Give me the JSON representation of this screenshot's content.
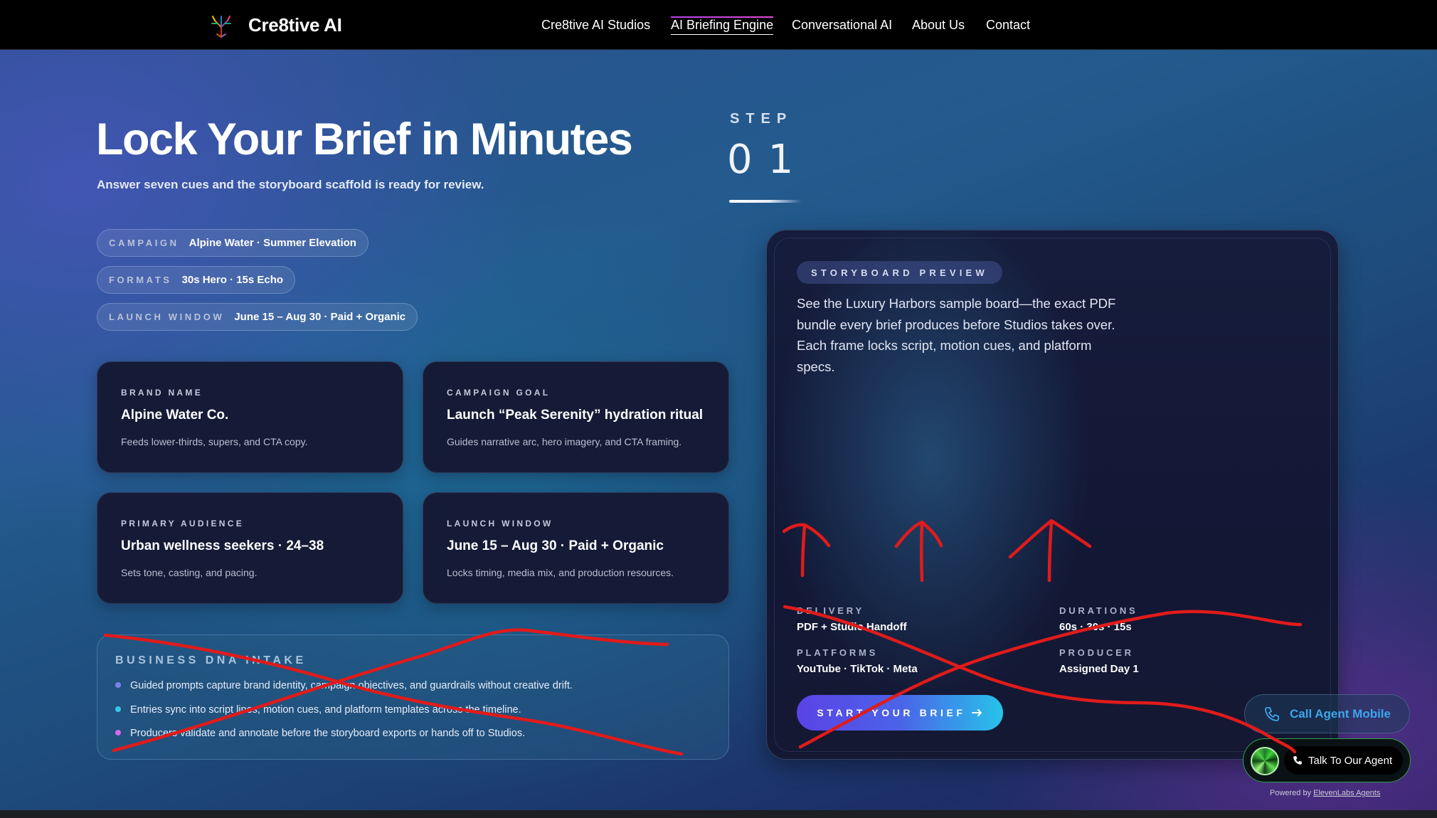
{
  "nav": {
    "brand": "Cre8tive AI",
    "links": [
      {
        "label": "Cre8tive AI Studios"
      },
      {
        "label": "AI Briefing Engine"
      },
      {
        "label": "Conversational AI"
      },
      {
        "label": "About Us"
      },
      {
        "label": "Contact"
      }
    ],
    "active_link": "AI Briefing Engine"
  },
  "hero": {
    "title": "Lock Your Brief in Minutes",
    "subtitle": "Answer seven cues and the storyboard scaffold is ready for review."
  },
  "step": {
    "label": "STEP",
    "number": "01"
  },
  "pills": [
    {
      "key": "CAMPAIGN",
      "value": "Alpine Water · Summer Elevation"
    },
    {
      "key": "FORMATS",
      "value": "30s Hero · 15s Echo"
    },
    {
      "key": "LAUNCH WINDOW",
      "value": "June 15 – Aug 30 · Paid + Organic"
    }
  ],
  "cards": [
    {
      "key": "BRAND NAME",
      "title": "Alpine Water Co.",
      "desc": "Feeds lower-thirds, supers, and CTA copy."
    },
    {
      "key": "CAMPAIGN GOAL",
      "title": "Launch “Peak Serenity” hydration ritual",
      "desc": "Guides narrative arc, hero imagery, and CTA framing."
    },
    {
      "key": "PRIMARY AUDIENCE",
      "title": "Urban wellness seekers · 24–38",
      "desc": "Sets tone, casting, and pacing."
    },
    {
      "key": "LAUNCH WINDOW",
      "title": "June 15 – Aug 30 · Paid + Organic",
      "desc": "Locks timing, media mix, and production resources."
    }
  ],
  "intake": {
    "title": "BUSINESS DNA INTAKE",
    "items": [
      {
        "text": "Guided prompts capture brand identity, campaign objectives, and guardrails without creative drift.",
        "color": "#7b82e8"
      },
      {
        "text": "Entries sync into script lines, motion cues, and platform templates across the timeline.",
        "color": "#35c9e6"
      },
      {
        "text": "Producers validate and annotate before the storyboard exports or hands off to Studios.",
        "color": "#d36be8"
      }
    ]
  },
  "preview": {
    "tag": "STORYBOARD PREVIEW",
    "body": "See the Luxury Harbors sample board—the exact PDF bundle every brief produces before Studios takes over. Each frame locks script, motion cues, and platform specs.",
    "specs": [
      {
        "key": "DELIVERY",
        "value": "PDF + Studio Handoff"
      },
      {
        "key": "DURATIONS",
        "value": "60s · 30s · 15s"
      },
      {
        "key": "PLATFORMS",
        "value": "YouTube · TikTok · Meta"
      },
      {
        "key": "PRODUCER",
        "value": "Assigned Day 1"
      }
    ],
    "cta_label": "START YOUR BRIEF"
  },
  "agent": {
    "call_mobile_label": "Call Agent Mobile",
    "talk_label": "Talk To Our Agent",
    "powered_prefix": "Powered by",
    "powered_link": "ElevenLabs Agents"
  },
  "icons": {
    "logo": "tree-logo-icon",
    "cta_arrow": "arrow-right-icon",
    "call": "phone-icon"
  },
  "colors": {
    "accent_purple": "#b545e6",
    "cta_start": "#5a43e6",
    "cta_end": "#27c3ea",
    "agent_blue": "#3ca6ee",
    "agent_border": "#2fa04a",
    "annotation_red": "#e01b1b"
  }
}
